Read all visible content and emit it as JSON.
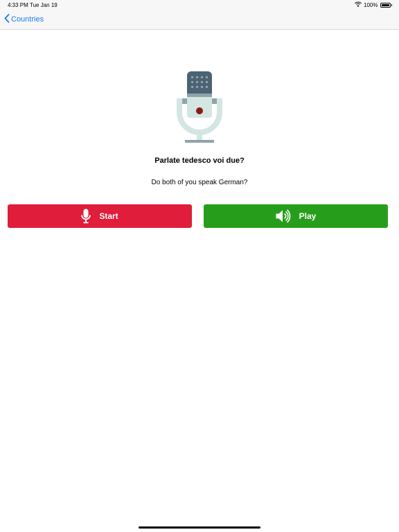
{
  "status_bar": {
    "time": "4:33 PM",
    "date": "Tue Jan 19",
    "battery": "100%",
    "icons": [
      "wifi-icon",
      "battery-icon"
    ]
  },
  "nav": {
    "back_label": "Countries",
    "back_icon": "chevron-left-icon"
  },
  "phrase": {
    "title": "Parlate tedesco voi due?",
    "translation": "Do both of you speak German?"
  },
  "buttons": {
    "start_label": "Start",
    "start_icon": "microphone-icon",
    "play_label": "Play",
    "play_icon": "speaker-icon"
  },
  "colors": {
    "accent": "#1a7cf6",
    "start": "#e01d3a",
    "play": "#279e1b"
  }
}
